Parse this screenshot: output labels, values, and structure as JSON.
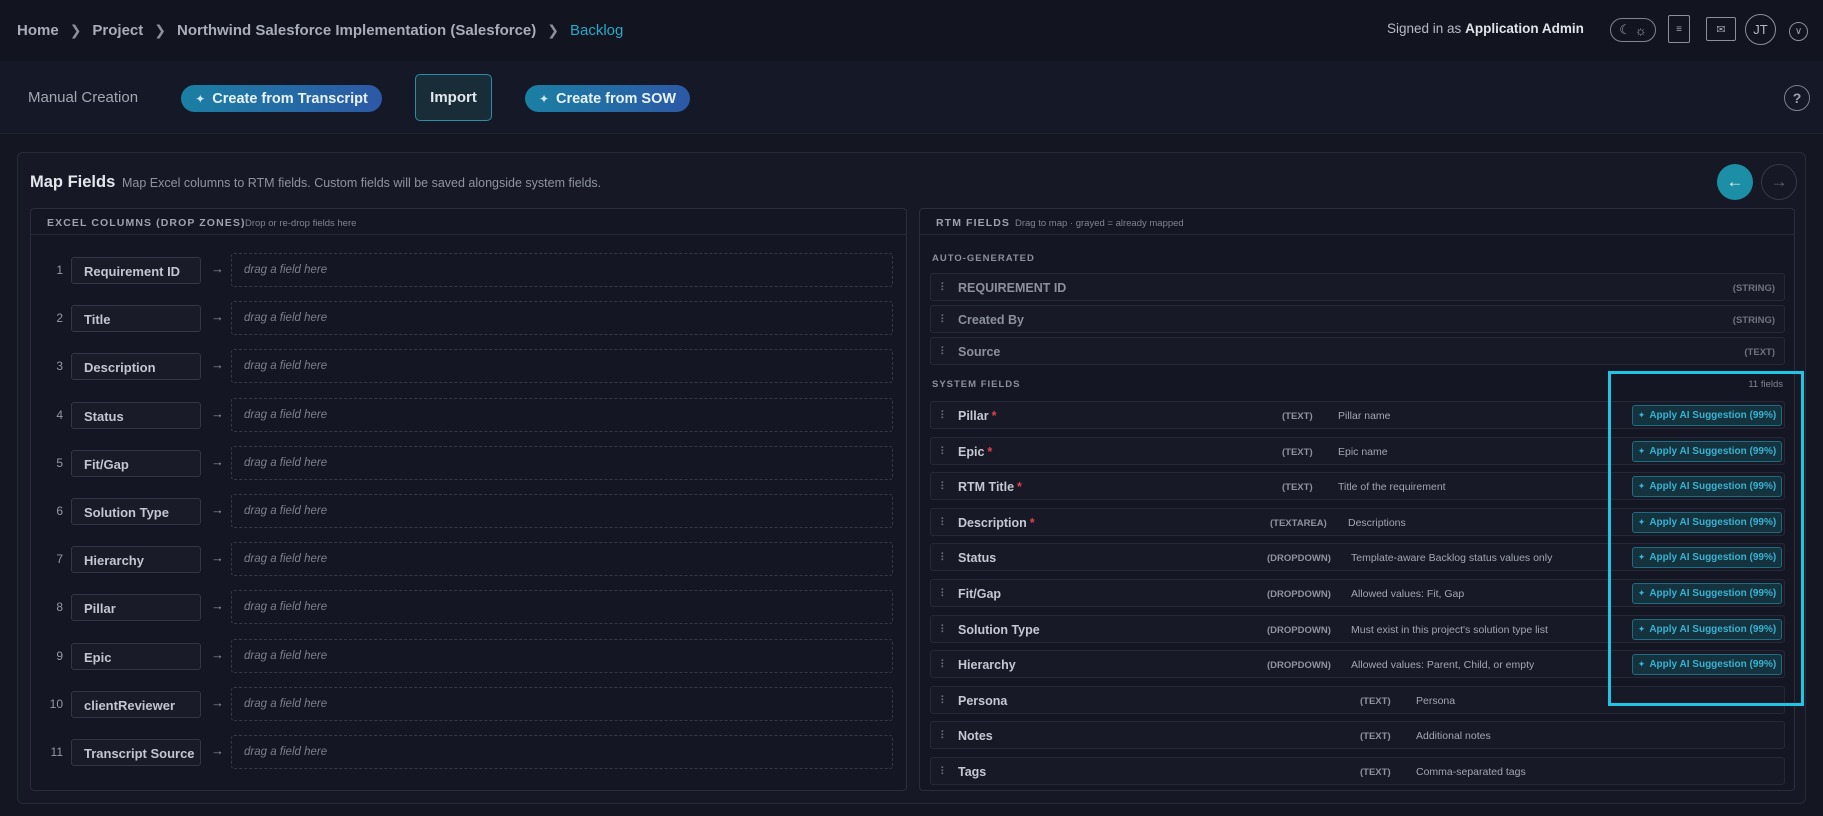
{
  "breadcrumb": {
    "items": [
      "Home",
      "Project",
      "Northwind Salesforce Implementation (Salesforce)"
    ],
    "current": "Backlog"
  },
  "header": {
    "signed_prefix": "Signed in as",
    "signed_user": "Application Admin",
    "avatar_initials": "JT",
    "icons": [
      "moon-icon",
      "sun-icon",
      "book-icon",
      "mail-icon",
      "chevron-down-icon"
    ]
  },
  "actions": {
    "manual": "Manual Creation",
    "transcript": "Create from Transcript",
    "import": "Import",
    "sow": "Create from SOW",
    "help": "?"
  },
  "map": {
    "title": "Map Fields",
    "subtitle": "Map Excel columns to RTM fields. Custom fields will be saved alongside system fields."
  },
  "excel": {
    "title": "EXCEL COLUMNS (DROP ZONES)",
    "subtitle": "Drop or re-drop fields here",
    "placeholder": "drag a field here",
    "columns": [
      {
        "num": "1",
        "name": "Requirement ID"
      },
      {
        "num": "2",
        "name": "Title"
      },
      {
        "num": "3",
        "name": "Description"
      },
      {
        "num": "4",
        "name": "Status"
      },
      {
        "num": "5",
        "name": "Fit/Gap"
      },
      {
        "num": "6",
        "name": "Solution Type"
      },
      {
        "num": "7",
        "name": "Hierarchy"
      },
      {
        "num": "8",
        "name": "Pillar"
      },
      {
        "num": "9",
        "name": "Epic"
      },
      {
        "num": "10",
        "name": "clientReviewer"
      },
      {
        "num": "11",
        "name": "Transcript Source"
      }
    ]
  },
  "rtm": {
    "title": "RTM FIELDS",
    "subtitle": "Drag to map · grayed = already mapped",
    "auto_label": "AUTO-GENERATED",
    "auto": [
      {
        "name": "REQUIREMENT ID",
        "type": "(STRING)"
      },
      {
        "name": "Created By",
        "type": "(STRING)"
      },
      {
        "name": "Source",
        "type": "(TEXT)"
      }
    ],
    "system_label": "SYSTEM FIELDS",
    "system_count": "11 fields",
    "ai_label": "Apply AI Suggestion (99%)",
    "system": [
      {
        "name": "Pillar",
        "type": "(TEXT)",
        "desc": "Pillar name",
        "req": "*"
      },
      {
        "name": "Epic",
        "type": "(TEXT)",
        "desc": "Epic name",
        "req": "*"
      },
      {
        "name": "RTM Title",
        "type": "(TEXT)",
        "desc": "Title of the requirement",
        "req": "*"
      },
      {
        "name": "Description",
        "type": "(TEXTAREA)",
        "desc": "Descriptions",
        "req": "*"
      },
      {
        "name": "Status",
        "type": "(DROPDOWN)",
        "desc": "Template-aware Backlog status values only",
        "req": ""
      },
      {
        "name": "Fit/Gap",
        "type": "(DROPDOWN)",
        "desc": "Allowed values: Fit, Gap",
        "req": ""
      },
      {
        "name": "Solution Type",
        "type": "(DROPDOWN)",
        "desc": "Must exist in this project's solution type list",
        "req": ""
      },
      {
        "name": "Hierarchy",
        "type": "(DROPDOWN)",
        "desc": "Allowed values: Parent, Child, or empty",
        "req": ""
      },
      {
        "name": "Persona",
        "type": "(TEXT)",
        "desc": "Persona",
        "req": ""
      },
      {
        "name": "Notes",
        "type": "(TEXT)",
        "desc": "Additional notes",
        "req": ""
      },
      {
        "name": "Tags",
        "type": "(TEXT)",
        "desc": "Comma-separated tags",
        "req": ""
      }
    ]
  },
  "colors": {
    "accent": "#27a9c7",
    "highlight": "#1fc5e3",
    "required": "#e0414a",
    "background": "#141622"
  }
}
